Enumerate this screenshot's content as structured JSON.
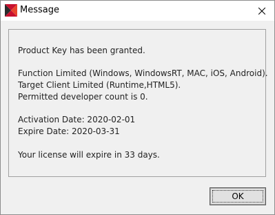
{
  "window": {
    "title": "Message",
    "close_icon": "close-icon",
    "app_icon": "app-logo-icon"
  },
  "message": {
    "line1": "Product Key has been granted.",
    "line2": "Function Limited (Windows, WindowsRT, MAC, iOS, Android).",
    "line3": "Target Client Limited (Runtime,HTML5).",
    "line4": "Permitted developer count is 0.",
    "line5": "Activation Date: 2020-02-01",
    "line6": "Expire Date: 2020-03-31",
    "line7": "Your license will expire in 33 days."
  },
  "buttons": {
    "ok_label": "OK"
  },
  "colors": {
    "logo_red": "#c8102e",
    "logo_dark": "#2b2b2b"
  }
}
